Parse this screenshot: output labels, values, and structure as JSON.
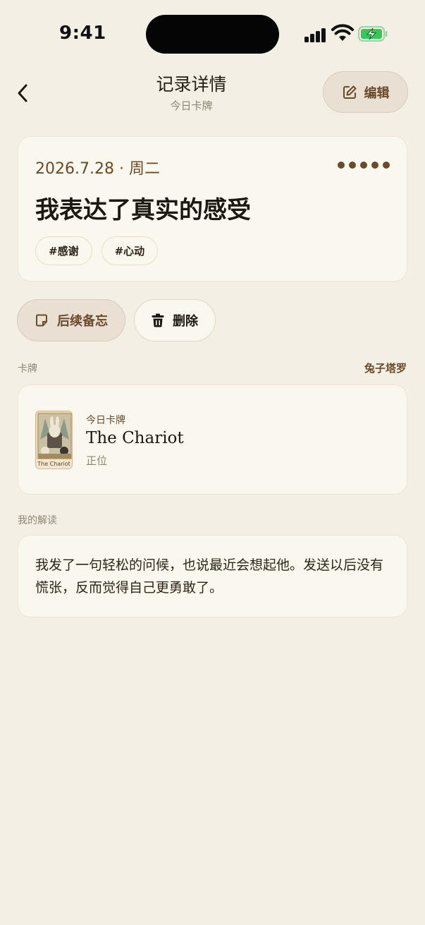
{
  "status": {
    "time": "9:41"
  },
  "nav": {
    "title": "记录详情",
    "subtitle": "今日卡牌",
    "edit_label": "编辑"
  },
  "entry": {
    "date": "2026.7.28 · 周二",
    "title": "我表达了真实的感受",
    "tags": [
      "#感谢",
      "#心动"
    ]
  },
  "actions": {
    "memo_label": "后续备忘",
    "delete_label": "删除"
  },
  "card_section": {
    "label": "卡牌",
    "deck": "兔子塔罗"
  },
  "card": {
    "caption": "今日卡牌",
    "name": "The Chariot",
    "orientation": "正位",
    "thumb_caption": "The Chariot"
  },
  "reading_section": {
    "label": "我的解读",
    "text": "我发了一句轻松的问候，也说最近会想起他。发送以后没有慌张，反而觉得自己更勇敢了。"
  },
  "colors": {
    "accent": "#6a4a2c",
    "background": "#f4efe4",
    "card": "#faf7ee",
    "battery": "#34c759"
  }
}
